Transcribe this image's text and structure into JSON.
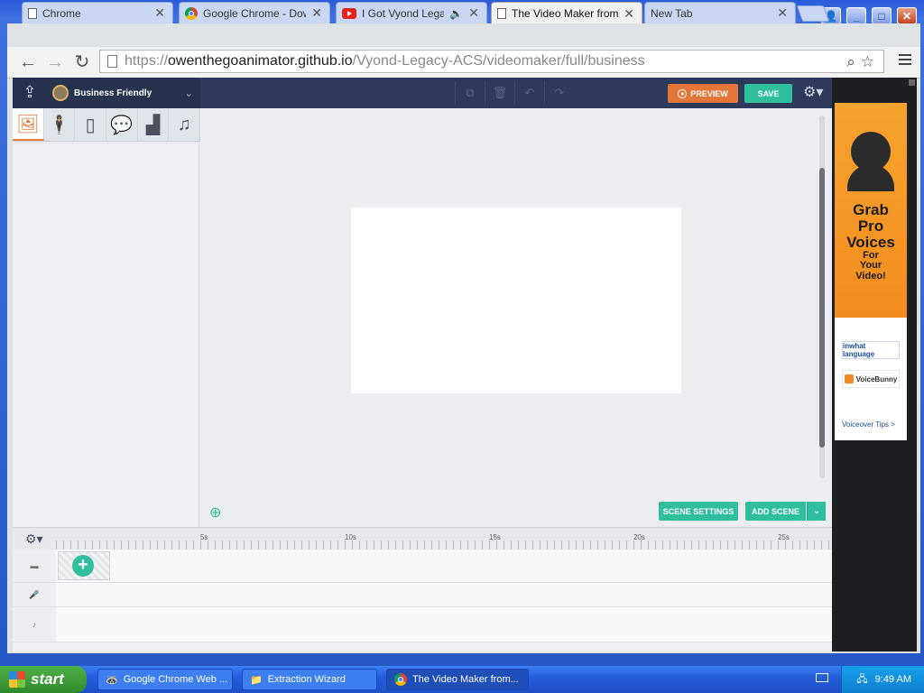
{
  "browser": {
    "tabs": [
      {
        "title": "Chrome",
        "favicon": "document-icon",
        "active": false
      },
      {
        "title": "Google Chrome - Downlo",
        "favicon": "chrome-icon",
        "active": false
      },
      {
        "title": "I Got Vyond Legacy",
        "favicon": "youtube-icon",
        "active": false,
        "audio": true
      },
      {
        "title": "The Video Maker from Vy",
        "favicon": "document-icon",
        "active": true
      },
      {
        "title": "New Tab",
        "favicon": "none",
        "active": false
      }
    ],
    "close_glyph": "✕",
    "url_scheme": "https://",
    "url_host": "owenthegoanimator.github.io",
    "url_path": "/Vyond-Legacy-ACS/videomaker/full/business"
  },
  "app": {
    "theme_name": "Business Friendly",
    "preview_label": "PREVIEW",
    "save_label": "SAVE",
    "scene_settings_label": "SCENE SETTINGS",
    "add_scene_label": "ADD SCENE",
    "library_tabs": [
      "background-icon",
      "character-icon",
      "prop-icon",
      "bubble-icon",
      "chart-icon",
      "music-icon"
    ],
    "accent_color": "#2fbf9f",
    "preview_color": "#e5763a"
  },
  "timeline": {
    "markers": [
      "5s",
      "10s",
      "15s",
      "20s",
      "25s"
    ]
  },
  "ad": {
    "line1": "Grab",
    "line2": "Pro",
    "line3": "Voices",
    "line4": "For",
    "line5": "Your",
    "line6": "Video!",
    "logo1": "inwhat language",
    "logo2": "VoiceBunny",
    "tips": "Voiceover Tips >"
  },
  "taskbar": {
    "start_label": "start",
    "tasks": [
      {
        "title": "Google Chrome Web ..."
      },
      {
        "title": "Extraction Wizard"
      },
      {
        "title": "The Video Maker from..."
      }
    ],
    "clock": "9:49 AM"
  }
}
